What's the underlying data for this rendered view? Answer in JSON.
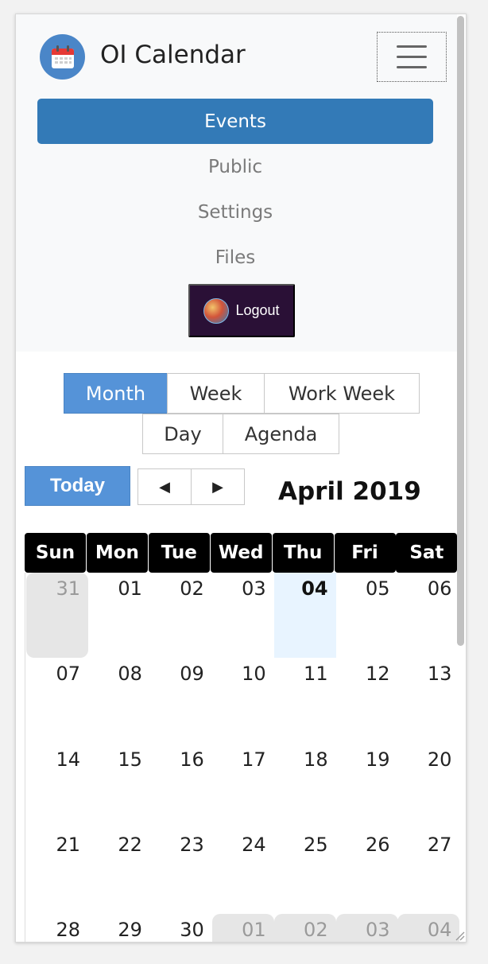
{
  "app": {
    "title": "OI Calendar",
    "logo_icon": "calendar-icon",
    "menu_icon": "hamburger-icon"
  },
  "nav": {
    "items": [
      {
        "label": "Events",
        "active": true
      },
      {
        "label": "Public",
        "active": false
      },
      {
        "label": "Settings",
        "active": false
      },
      {
        "label": "Files",
        "active": false
      }
    ],
    "logout_label": "Logout"
  },
  "views": {
    "month": "Month",
    "week": "Week",
    "work_week": "Work Week",
    "day": "Day",
    "agenda": "Agenda",
    "selected": "Month"
  },
  "toolbar": {
    "today_label": "Today",
    "prev_glyph": "◀",
    "next_glyph": "▶",
    "current_period": "April 2019"
  },
  "calendar": {
    "weekdays": [
      "Sun",
      "Mon",
      "Tue",
      "Wed",
      "Thu",
      "Fri",
      "Sat"
    ],
    "weeks": [
      [
        {
          "d": "31",
          "other": true
        },
        {
          "d": "01"
        },
        {
          "d": "02"
        },
        {
          "d": "03"
        },
        {
          "d": "04",
          "today": true
        },
        {
          "d": "05"
        },
        {
          "d": "06"
        }
      ],
      [
        {
          "d": "07"
        },
        {
          "d": "08"
        },
        {
          "d": "09"
        },
        {
          "d": "10"
        },
        {
          "d": "11"
        },
        {
          "d": "12"
        },
        {
          "d": "13"
        }
      ],
      [
        {
          "d": "14"
        },
        {
          "d": "15"
        },
        {
          "d": "16"
        },
        {
          "d": "17"
        },
        {
          "d": "18"
        },
        {
          "d": "19"
        },
        {
          "d": "20"
        }
      ],
      [
        {
          "d": "21"
        },
        {
          "d": "22"
        },
        {
          "d": "23"
        },
        {
          "d": "24"
        },
        {
          "d": "25"
        },
        {
          "d": "26"
        },
        {
          "d": "27"
        }
      ],
      [
        {
          "d": "28"
        },
        {
          "d": "29"
        },
        {
          "d": "30"
        },
        {
          "d": "01",
          "other": true
        },
        {
          "d": "02",
          "other": true
        },
        {
          "d": "03",
          "other": true
        },
        {
          "d": "04",
          "other": true
        }
      ]
    ]
  },
  "colors": {
    "accent": "#337ab7",
    "view_active": "#5593d8",
    "logout_bg": "#2a1036",
    "header_bg": "#000000",
    "today_bg": "#e8f4ff",
    "other_month_bg": "#e6e6e6"
  }
}
